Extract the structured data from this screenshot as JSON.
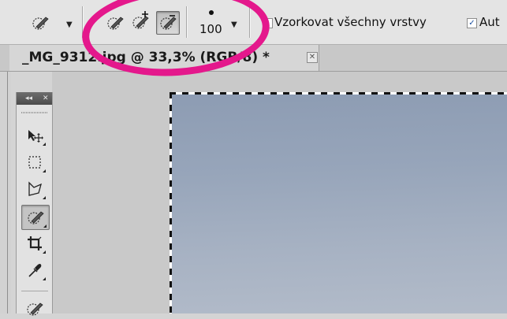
{
  "options_bar": {
    "tool_preset_icon": "quick-selection-brush-icon",
    "selection_modes": [
      {
        "icon": "new-selection-icon",
        "active": false
      },
      {
        "icon": "add-to-selection-icon",
        "active": false
      },
      {
        "icon": "subtract-from-selection-icon",
        "active": true
      }
    ],
    "brush_size": "100",
    "sample_all_layers": {
      "label": "Vzorkovat všechny vrstvy",
      "checked": false
    },
    "auto_enhance": {
      "label": "Aut",
      "checked": true
    }
  },
  "document_tab": {
    "title": "_MG_9312.jpg @ 33,3% (RGB/8) *",
    "close_glyph": "✕"
  },
  "toolbox": {
    "collapse_glyph": "◂◂",
    "close_glyph": "✕",
    "tools": [
      {
        "icon": "move-icon",
        "active": false
      },
      {
        "icon": "rectangular-marquee-icon",
        "active": false
      },
      {
        "icon": "polygonal-lasso-icon",
        "active": false
      },
      {
        "icon": "quick-selection-icon",
        "active": true
      },
      {
        "icon": "crop-icon",
        "active": false
      },
      {
        "icon": "eyedropper-icon",
        "active": false
      }
    ]
  },
  "colors": {
    "annotation": "#e4188c",
    "ui_background": "#e4e4e4",
    "photo_sky": "#9aa8bc"
  }
}
